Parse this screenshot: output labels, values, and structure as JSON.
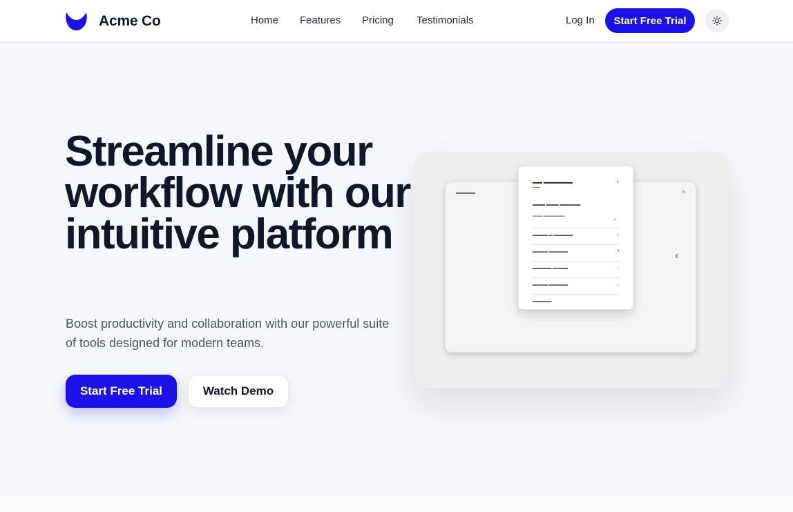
{
  "colors": {
    "brand": "#1a12e8",
    "heading": "#0f172a",
    "body_text": "#4b5563",
    "background": "#f6f7fa",
    "accent_red": "#e4572e"
  },
  "header": {
    "logo_icon": "crescent-logo-icon",
    "brand_name": "Acme Co",
    "nav": [
      {
        "label": "Home"
      },
      {
        "label": "Features"
      },
      {
        "label": "Pricing"
      },
      {
        "label": "Testimonials"
      }
    ],
    "login_label": "Log In",
    "trial_label": "Start Free Trial",
    "theme_icon": "sun-icon"
  },
  "hero": {
    "title": "Streamline your workflow with our intuitive platform",
    "subtitle": "Boost productivity and collaboration with our powerful suite of tools designed for modern teams.",
    "primary_cta": "Start Free Trial",
    "secondary_cta": "Watch Demo"
  }
}
